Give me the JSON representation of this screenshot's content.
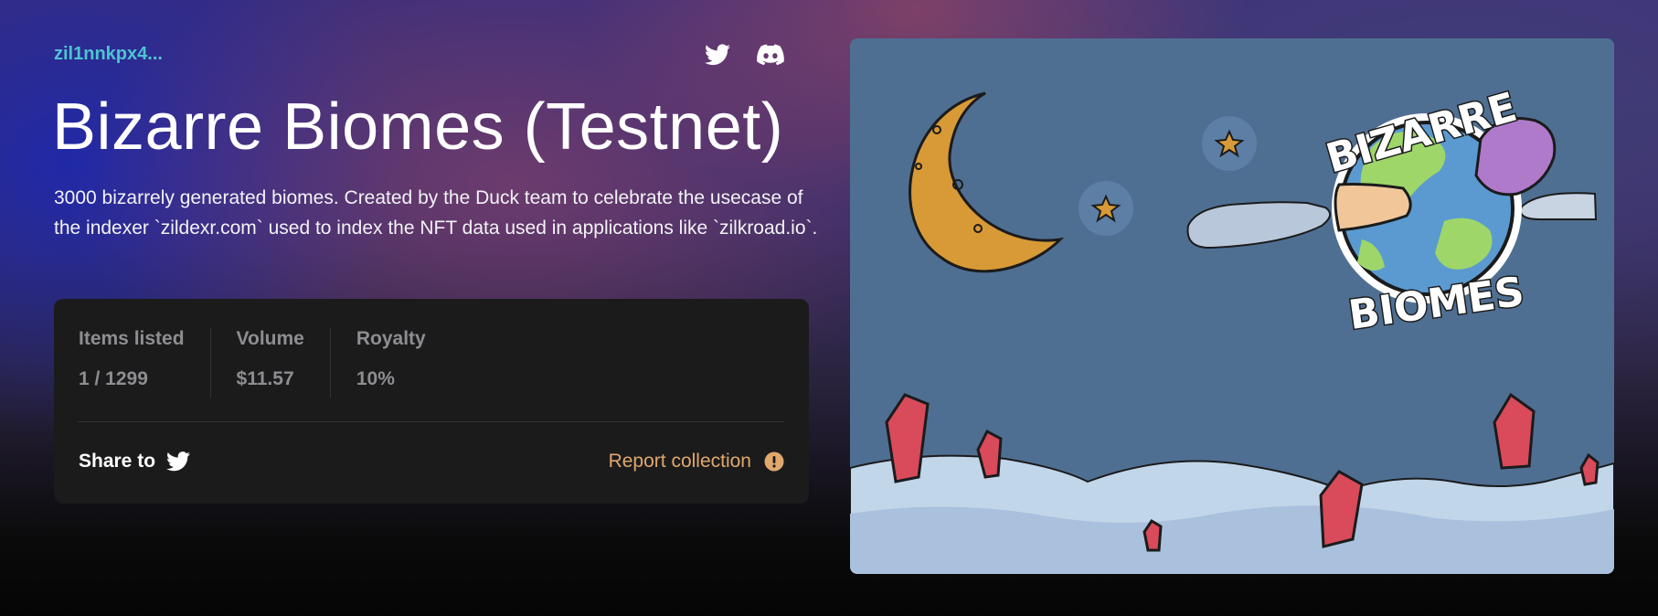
{
  "collection": {
    "address": "zil1nnkpx4...",
    "title": "Bizarre Biomes (Testnet)",
    "description": "3000 bizarrely generated biomes. Created by the Duck team to celebrate the usecase of the indexer `zildexr.com` used to index the NFT data used in applications like `zilkroad.io`."
  },
  "socials": {
    "icons": [
      "twitter-icon",
      "discord-icon"
    ]
  },
  "stats": [
    {
      "label": "Items listed",
      "value": "1 / 1299"
    },
    {
      "label": "Volume",
      "value": "$11.57"
    },
    {
      "label": "Royalty",
      "value": "10%"
    }
  ],
  "actions": {
    "share_label": "Share to",
    "report_label": "Report collection"
  },
  "banner": {
    "logo_top": "BIZARRE",
    "logo_bottom": "BIOMES"
  },
  "colors": {
    "address": "#4fc3d0",
    "report": "#e0a86c",
    "card_bg": "#1b1b1c",
    "banner_bg": "#4f6f92"
  }
}
